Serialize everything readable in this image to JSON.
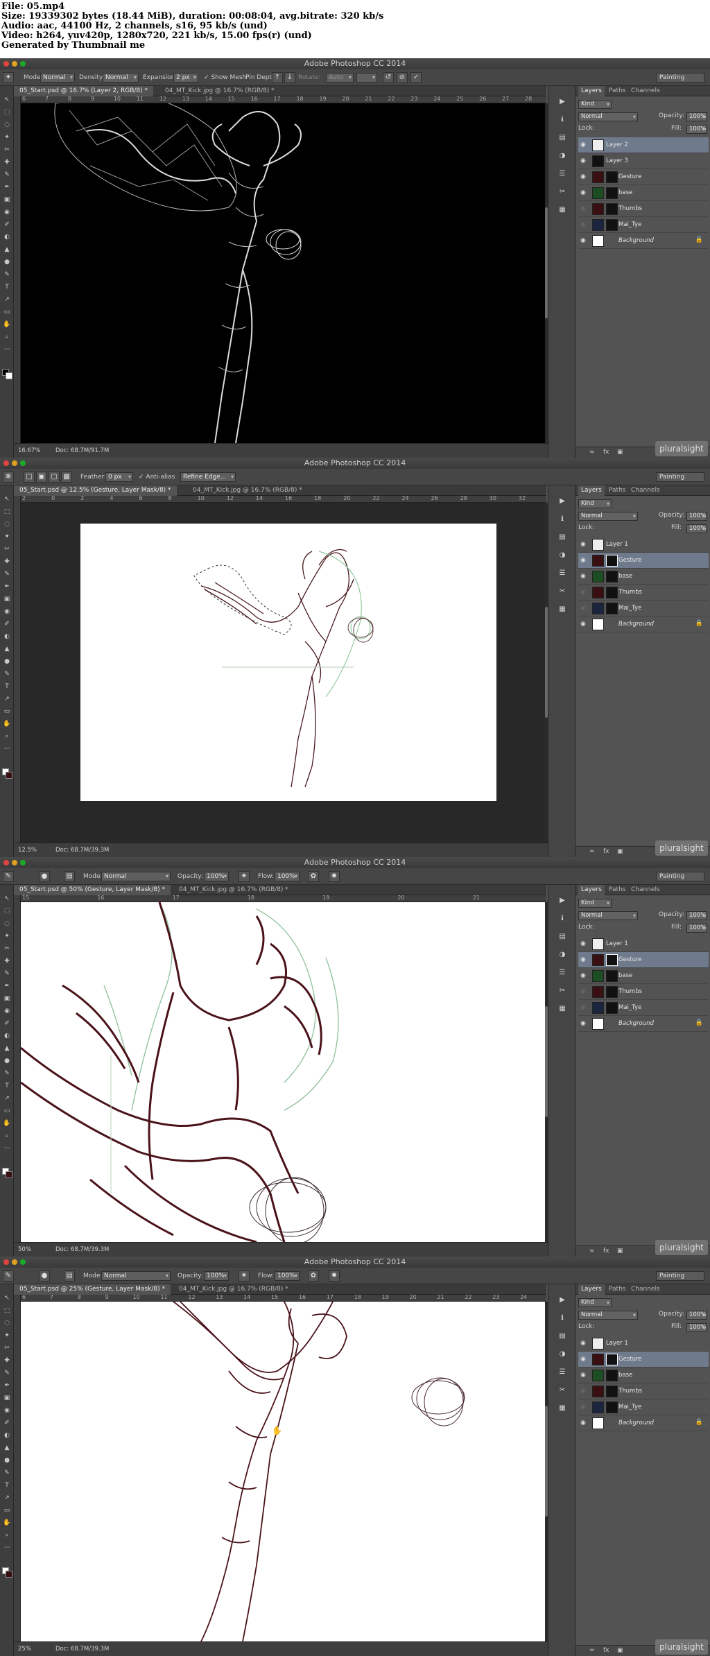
{
  "header": {
    "lines": [
      "File: 05.mp4",
      "Size: 19339302 bytes (18.44 MiB), duration: 00:08:04, avg.bitrate: 320 kb/s",
      "Audio: aac, 44100 Hz, 2 channels, s16, 95 kb/s (und)",
      "Video: h264, yuv420p, 1280x720, 221 kb/s, 15.00 fps(r) (und)",
      "Generated by Thumbnail me"
    ]
  },
  "frames": [
    {
      "title": "Adobe Photoshop CC 2014",
      "options": {
        "mode_label": "Mode:",
        "mode_value": "Normal",
        "density_label": "Density:",
        "density_value": "Normal",
        "expansion_label": "Expansion:",
        "expansion_value": "2 px",
        "show_mesh": "Show Mesh",
        "pin_depth": "Pin Depth:",
        "rotate_label": "Rotate:",
        "rotate_value": "Auto"
      },
      "workspace": "Painting",
      "tabs": [
        "05_Start.psd @ 16.7% (Layer 2, RGB/8) *",
        "04_MT_Kick.jpg @ 16.7% (RGB/8) *"
      ],
      "ruler": [
        "6",
        "7",
        "8",
        "9",
        "10",
        "11",
        "12",
        "13",
        "14",
        "15",
        "16",
        "17",
        "18",
        "19",
        "20",
        "21",
        "22",
        "23",
        "24",
        "25",
        "26",
        "27",
        "28"
      ],
      "status_zoom": "16.67%",
      "status_doc": "Doc: 68.7M/91.7M",
      "panel": {
        "tabs": [
          "Layers",
          "Paths",
          "Channels"
        ],
        "kind": "Kind",
        "blend": "Normal",
        "opacity_label": "Opacity:",
        "opacity": "100%",
        "lock_label": "Lock:",
        "fill_label": "Fill:",
        "fill": "100%",
        "layers": [
          "Layer 2",
          "Layer 3",
          "Gesture",
          "base",
          "Thumbs",
          "Mai_Tye",
          "Background"
        ],
        "selected": 0
      },
      "watermark": "pluralsight"
    },
    {
      "title": "Adobe Photoshop CC 2014",
      "options": {
        "feather_label": "Feather:",
        "feather_value": "0 px",
        "anti_alias": "Anti-alias",
        "refine_edge": "Refine Edge..."
      },
      "workspace": "Painting",
      "tabs": [
        "05_Start.psd @ 12.5% (Gesture, Layer Mask/8) *",
        "04_MT_Kick.jpg @ 16.7% (RGB/8) *"
      ],
      "ruler": [
        "2",
        "0",
        "2",
        "4",
        "6",
        "8",
        "10",
        "12",
        "14",
        "16",
        "18",
        "20",
        "22",
        "24",
        "26",
        "28",
        "30",
        "32"
      ],
      "status_zoom": "12.5%",
      "status_doc": "Doc: 68.7M/39.3M",
      "panel": {
        "tabs": [
          "Layers",
          "Paths",
          "Channels"
        ],
        "kind": "Kind",
        "blend": "Normal",
        "opacity_label": "Opacity:",
        "opacity": "100%",
        "lock_label": "Lock:",
        "fill_label": "Fill:",
        "fill": "100%",
        "layers": [
          "Layer 1",
          "Gesture",
          "base",
          "Thumbs",
          "Mai_Tye",
          "Background"
        ],
        "selected": 1
      },
      "watermark": "pluralsight"
    },
    {
      "title": "Adobe Photoshop CC 2014",
      "options": {
        "mode_label": "Mode:",
        "mode_value": "Normal",
        "opacity_label": "Opacity:",
        "opacity_value": "100%",
        "flow_label": "Flow:",
        "flow_value": "100%"
      },
      "workspace": "Painting",
      "tabs": [
        "05_Start.psd @ 50% (Gesture, Layer Mask/8) *",
        "04_MT_Kick.jpg @ 16.7% (RGB/8) *"
      ],
      "ruler": [
        "15",
        "16",
        "17",
        "18",
        "19",
        "20",
        "21"
      ],
      "status_zoom": "50%",
      "status_doc": "Doc: 68.7M/39.3M",
      "panel": {
        "tabs": [
          "Layers",
          "Paths",
          "Channels"
        ],
        "kind": "Kind",
        "blend": "Normal",
        "opacity_label": "Opacity:",
        "opacity": "100%",
        "lock_label": "Lock:",
        "fill_label": "Fill:",
        "fill": "100%",
        "layers": [
          "Layer 1",
          "Gesture",
          "base",
          "Thumbs",
          "Mai_Tye",
          "Background"
        ],
        "selected": 1
      },
      "watermark": "pluralsight"
    },
    {
      "title": "Adobe Photoshop CC 2014",
      "options": {
        "mode_label": "Mode:",
        "mode_value": "Normal",
        "opacity_label": "Opacity:",
        "opacity_value": "100%",
        "flow_label": "Flow:",
        "flow_value": "100%"
      },
      "workspace": "Painting",
      "tabs": [
        "05_Start.psd @ 25% (Gesture, Layer Mask/8) *",
        "04_MT_Kick.jpg @ 16.7% (RGB/8) *"
      ],
      "ruler": [
        "6",
        "7",
        "8",
        "9",
        "10",
        "11",
        "12",
        "13",
        "14",
        "15",
        "16",
        "17",
        "18",
        "19",
        "20",
        "21",
        "22",
        "23",
        "24"
      ],
      "status_zoom": "25%",
      "status_doc": "Doc: 68.7M/39.3M",
      "panel": {
        "tabs": [
          "Layers",
          "Paths",
          "Channels"
        ],
        "kind": "Kind",
        "blend": "Normal",
        "opacity_label": "Opacity:",
        "opacity": "100%",
        "lock_label": "Lock:",
        "fill_label": "Fill:",
        "fill": "100%",
        "layers": [
          "Layer 1",
          "Gesture",
          "base",
          "Thumbs",
          "Mai_Tye",
          "Background"
        ],
        "selected": 1
      },
      "watermark": "pluralsight"
    }
  ]
}
